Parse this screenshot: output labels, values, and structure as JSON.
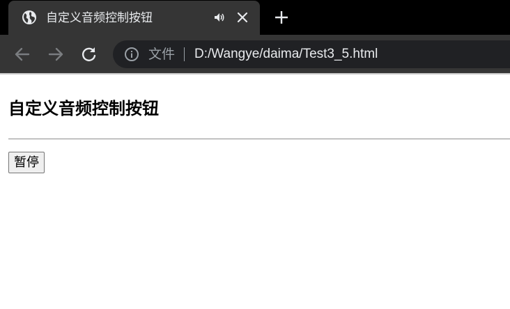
{
  "browser": {
    "tab": {
      "title": "自定义音频控制按钮",
      "favicon": "globe-icon",
      "audio_indicator": "speaker-icon",
      "close": "close-icon"
    },
    "new_tab": "plus-icon",
    "nav": {
      "back": "arrow-left-icon",
      "forward": "arrow-right-icon",
      "reload": "reload-icon"
    },
    "omnibox": {
      "info_icon": "info-icon",
      "scheme_label": "文件",
      "url": "D:/Wangye/daima/Test3_5.html"
    },
    "colors": {
      "tabbar_bg": "#000000",
      "active_tab_bg": "#353535",
      "toolbar_bg": "#353535",
      "omnibox_bg": "#202124",
      "text": "#e8eaed"
    }
  },
  "page": {
    "heading": "自定义音频控制按钮",
    "pause_button_label": "暂停"
  }
}
